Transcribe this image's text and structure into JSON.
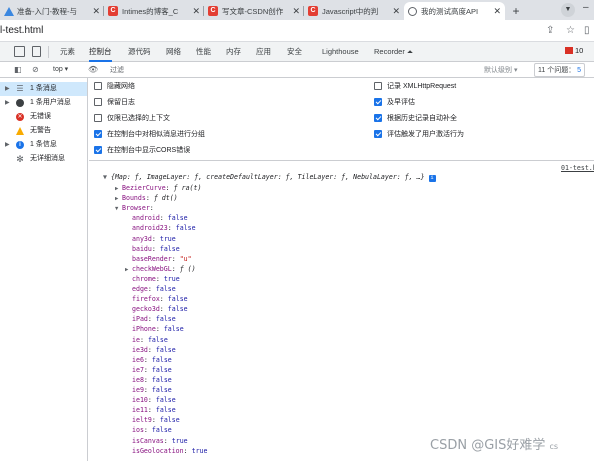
{
  "browser": {
    "tabs": [
      {
        "title": "准备-入门-教程-与",
        "icon": "triangle-icon"
      },
      {
        "title": "Intimes的博客_C",
        "icon": "csdn-icon"
      },
      {
        "title": "写文章-CSDN创作",
        "icon": "csdn-icon"
      },
      {
        "title": "Javascript中的判",
        "icon": "csdn-icon"
      },
      {
        "title": "我的测试高度API",
        "icon": "globe-icon"
      }
    ],
    "close_glyph": "✕",
    "new_tab_glyph": "+",
    "address": "l-test.html"
  },
  "devtools": {
    "tabs": [
      "元素",
      "控制台",
      "源代码",
      "网络",
      "性能",
      "内存",
      "应用",
      "安全",
      "Lighthouse",
      "Recorder ⏶"
    ],
    "active_tab": "控制台",
    "error_count": "10"
  },
  "console_toolbar": {
    "context": "top ▾",
    "filter_placeholder": "过滤",
    "levels": "默认级别 ▾",
    "issues": "11 个问题：",
    "issues_count": "5"
  },
  "sidebar": {
    "items": [
      {
        "label": "1 条消息",
        "icon": "list-icon"
      },
      {
        "label": "1 条用户消息",
        "icon": "user-icon"
      },
      {
        "label": "无错误",
        "icon": "error-icon"
      },
      {
        "label": "无警告",
        "icon": "warning-icon"
      },
      {
        "label": "1 条信息",
        "icon": "info-icon"
      },
      {
        "label": "无详细消息",
        "icon": "verbose-icon"
      }
    ]
  },
  "settings": {
    "left": [
      {
        "label": "隐藏网络",
        "checked": false
      },
      {
        "label": "保留日志",
        "checked": false
      },
      {
        "label": "仅限已选择的上下文",
        "checked": false
      },
      {
        "label": "在控制台中对相似消息进行分组",
        "checked": true
      },
      {
        "label": "在控制台中显示CORS错误",
        "checked": true
      }
    ],
    "right": [
      {
        "label": "记录 XMLHttpRequest",
        "checked": false
      },
      {
        "label": "及早评估",
        "checked": true
      },
      {
        "label": "根据历史记录自动补全",
        "checked": true
      },
      {
        "label": "评估触发了用户激活行为",
        "checked": true
      }
    ]
  },
  "console_output": {
    "source": "01-test.h",
    "summary": "{Map: ƒ, ImageLayer: ƒ, createDefaultLayer: ƒ, TileLayer: ƒ, NebulaLayer: ƒ, …}",
    "entries": [
      {
        "indent": 1,
        "caret": "▶",
        "key": "BezierCurve",
        "value": "ƒ ra(t)",
        "type": "fn"
      },
      {
        "indent": 1,
        "caret": "▶",
        "key": "Bounds",
        "value": "ƒ dt()",
        "type": "fn"
      },
      {
        "indent": 1,
        "caret": "▼",
        "key": "Browser",
        "value": "",
        "type": "obj"
      },
      {
        "indent": 2,
        "caret": "",
        "key": "android",
        "value": "false",
        "type": "bool"
      },
      {
        "indent": 2,
        "caret": "",
        "key": "android23",
        "value": "false",
        "type": "bool"
      },
      {
        "indent": 2,
        "caret": "",
        "key": "any3d",
        "value": "true",
        "type": "bool"
      },
      {
        "indent": 2,
        "caret": "",
        "key": "baidu",
        "value": "false",
        "type": "bool"
      },
      {
        "indent": 2,
        "caret": "",
        "key": "baseRender",
        "value": "\"u\"",
        "type": "str"
      },
      {
        "indent": 2,
        "caret": "▶",
        "key": "checkWebGL",
        "value": "ƒ ()",
        "type": "fn"
      },
      {
        "indent": 2,
        "caret": "",
        "key": "chrome",
        "value": "true",
        "type": "bool"
      },
      {
        "indent": 2,
        "caret": "",
        "key": "edge",
        "value": "false",
        "type": "bool"
      },
      {
        "indent": 2,
        "caret": "",
        "key": "firefox",
        "value": "false",
        "type": "bool"
      },
      {
        "indent": 2,
        "caret": "",
        "key": "gecko3d",
        "value": "false",
        "type": "bool"
      },
      {
        "indent": 2,
        "caret": "",
        "key": "iPad",
        "value": "false",
        "type": "bool"
      },
      {
        "indent": 2,
        "caret": "",
        "key": "iPhone",
        "value": "false",
        "type": "bool"
      },
      {
        "indent": 2,
        "caret": "",
        "key": "ie",
        "value": "false",
        "type": "bool"
      },
      {
        "indent": 2,
        "caret": "",
        "key": "ie3d",
        "value": "false",
        "type": "bool"
      },
      {
        "indent": 2,
        "caret": "",
        "key": "ie6",
        "value": "false",
        "type": "bool"
      },
      {
        "indent": 2,
        "caret": "",
        "key": "ie7",
        "value": "false",
        "type": "bool"
      },
      {
        "indent": 2,
        "caret": "",
        "key": "ie8",
        "value": "false",
        "type": "bool"
      },
      {
        "indent": 2,
        "caret": "",
        "key": "ie9",
        "value": "false",
        "type": "bool"
      },
      {
        "indent": 2,
        "caret": "",
        "key": "ie10",
        "value": "false",
        "type": "bool"
      },
      {
        "indent": 2,
        "caret": "",
        "key": "ie11",
        "value": "false",
        "type": "bool"
      },
      {
        "indent": 2,
        "caret": "",
        "key": "ielt9",
        "value": "false",
        "type": "bool"
      },
      {
        "indent": 2,
        "caret": "",
        "key": "ios",
        "value": "false",
        "type": "bool"
      },
      {
        "indent": 2,
        "caret": "",
        "key": "isCanvas",
        "value": "true",
        "type": "bool"
      },
      {
        "indent": 2,
        "caret": "",
        "key": "isGeolocation",
        "value": "true",
        "type": "bool"
      }
    ]
  },
  "watermark": {
    "text": "CSDN @GIS好难学",
    "suffix": "cs"
  }
}
